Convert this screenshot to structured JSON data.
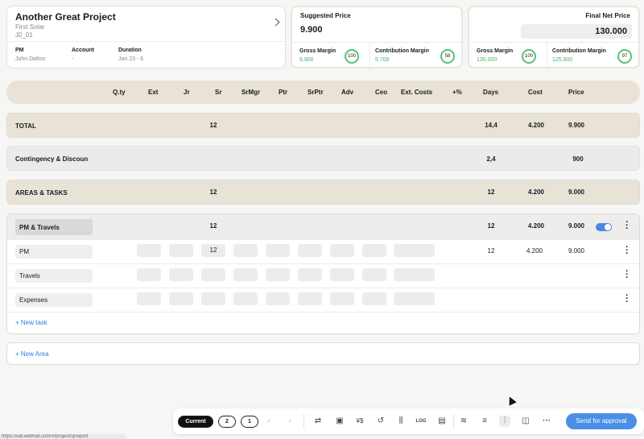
{
  "project": {
    "title": "Another Great Project",
    "client": "First Solar",
    "code": "J0_01",
    "pm_label": "PM",
    "pm_value": "John Dalton",
    "account_label": "Account",
    "account_value": "-",
    "duration_label": "Duration",
    "duration_value": "Jan 23 - 6"
  },
  "suggested": {
    "label": "Suggested Price",
    "value": "9.900",
    "gross_label": "Gross Margin",
    "gross_value": "9.900",
    "gross_pct": "100",
    "contrib_label": "Contribution Margin",
    "contrib_value": "5.700",
    "contrib_pct": "58"
  },
  "final": {
    "label": "Final Net Price",
    "value": "130.000",
    "gross_label": "Gross Margin",
    "gross_value": "130.000",
    "gross_pct": "100",
    "contrib_label": "Contribution Margin",
    "contrib_value": "125.800",
    "contrib_pct": "97"
  },
  "columns": [
    "Q.ty",
    "Ext",
    "Jr",
    "Sr",
    "SrMgr",
    "Ptr",
    "SrPtr",
    "Adv",
    "Ceo",
    "Ext. Costs",
    "+%",
    "Days",
    "Cost",
    "Price"
  ],
  "total": {
    "label": "TOTAL",
    "sr": "12",
    "days": "14,4",
    "cost": "4.200",
    "price": "9.900"
  },
  "contingency": {
    "label": "Contingency & Discoun",
    "days": "2,4",
    "price": "900"
  },
  "areas": {
    "label": "AREAS & TASKS",
    "sr": "12",
    "days": "12",
    "cost": "4.200",
    "price": "9.000"
  },
  "group": {
    "label": "PM & Travels",
    "sr": "12",
    "days": "12",
    "cost": "4.200",
    "price": "9.000",
    "rows": [
      {
        "label": "PM",
        "sr": "12",
        "days": "12",
        "cost": "4.200",
        "price": "9.000"
      },
      {
        "label": "Travels"
      },
      {
        "label": "Expenses"
      }
    ],
    "new_task": "+ New task"
  },
  "new_area": "+ New Area",
  "toolbar": {
    "current": "Current",
    "v2": "2",
    "v1": "1",
    "log": "LOG",
    "send": "Send for approval"
  },
  "status_url": "https://uat.wethod.com/#/project/q/report",
  "colors": {
    "accent": "#4a8ee6",
    "green": "#58c274",
    "band": "#e8e2d7"
  }
}
